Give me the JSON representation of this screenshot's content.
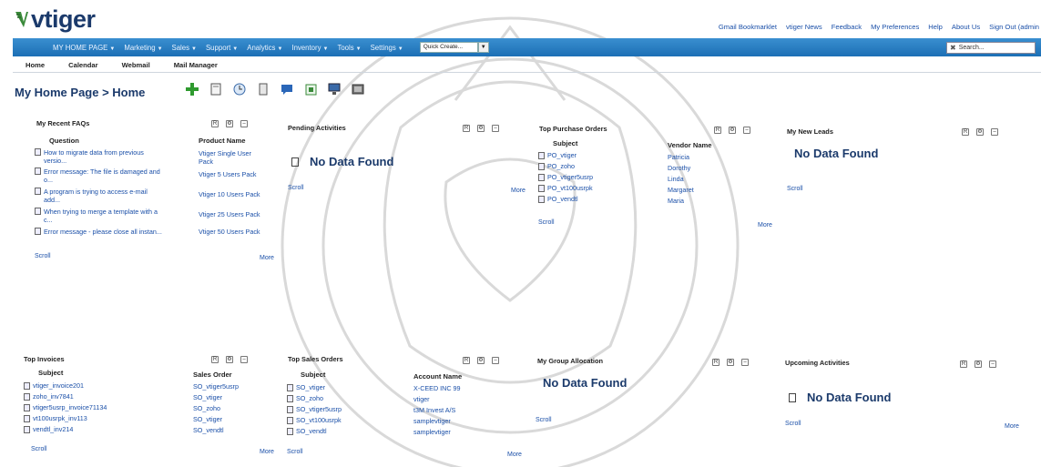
{
  "app": {
    "logo_text": "vtiger"
  },
  "top_links": [
    "Gmail Bookmarklet",
    "vtiger News",
    "Feedback",
    "My Preferences",
    "Help",
    "About Us",
    "Sign Out (admin"
  ],
  "menu": {
    "items": [
      "MY HOME PAGE",
      "Marketing",
      "Sales",
      "Support",
      "Analytics",
      "Inventory",
      "Tools",
      "Settings"
    ],
    "quick_create": "Quick Create...",
    "search_placeholder": "Search..."
  },
  "submenu": [
    "Home",
    "Calendar",
    "Webmail",
    "Mail Manager"
  ],
  "breadcrumb": "My Home Page > Home",
  "widgets": {
    "faqs": {
      "title": "My Recent FAQs",
      "col1": "Question",
      "col2": "Product Name",
      "questions": [
        "How to migrate data from previous",
        "versio...",
        "Error message: The file is damaged and",
        "o...",
        "A program is trying to access e-mail",
        "add...",
        "When trying to merge a template with a",
        "c...",
        "Error message - please close all instan..."
      ],
      "products": [
        "Vtiger Single User",
        "Pack",
        "Vtiger 5 Users Pack",
        "Vtiger 10 Users Pack",
        "Vtiger 25 Users Pack",
        "Vtiger 50 Users Pack"
      ],
      "scroll": "Scroll",
      "more": "More"
    },
    "pending": {
      "title": "Pending Activities",
      "no_data": "No Data Found",
      "scroll": "Scroll",
      "more": "More"
    },
    "purchase_orders": {
      "title": "Top Purchase Orders",
      "col1": "Subject",
      "col2": "Vendor Name",
      "subjects": [
        "PO_vtiger",
        "PO_zoho",
        "PO_vtiger5usrp",
        "PO_vt100usrpk",
        "PO_vendtl"
      ],
      "vendors": [
        "Patricia",
        "Dorothy",
        "Linda",
        "Margaret",
        "Maria"
      ],
      "scroll": "Scroll",
      "more": "More"
    },
    "new_leads": {
      "title": "My New Leads",
      "no_data": "No Data Found",
      "scroll": "Scroll"
    },
    "invoices": {
      "title": "Top Invoices",
      "col1": "Subject",
      "col2": "Sales Order",
      "subjects": [
        "vtiger_invoice201",
        "zoho_inv7841",
        "vtiger5usrp_invoice71134",
        "vt100usrpk_inv113",
        "vendtl_inv214"
      ],
      "orders": [
        "SO_vtiger5usrp",
        "SO_vtiger",
        "SO_zoho",
        "SO_vtiger",
        "SO_vendtl"
      ],
      "scroll": "Scroll",
      "more": "More"
    },
    "sales_orders": {
      "title": "Top Sales Orders",
      "col1": "Subject",
      "col2": "Account Name",
      "subjects": [
        "SO_vtiger",
        "SO_zoho",
        "SO_vtiger5usrp",
        "SO_vt100usrpk",
        "SO_vendtl"
      ],
      "accounts": [
        "X-CEED INC 99",
        "vtiger",
        "t3M Invest A/S",
        "samplevtiger",
        "samplevtiger"
      ],
      "scroll": "Scroll",
      "more": "More"
    },
    "group_allocation": {
      "title": "My Group Allocation",
      "no_data": "No Data Found",
      "scroll": "Scroll"
    },
    "upcoming": {
      "title": "Upcoming Activities",
      "no_data": "No Data Found",
      "scroll": "Scroll",
      "more": "More"
    }
  }
}
